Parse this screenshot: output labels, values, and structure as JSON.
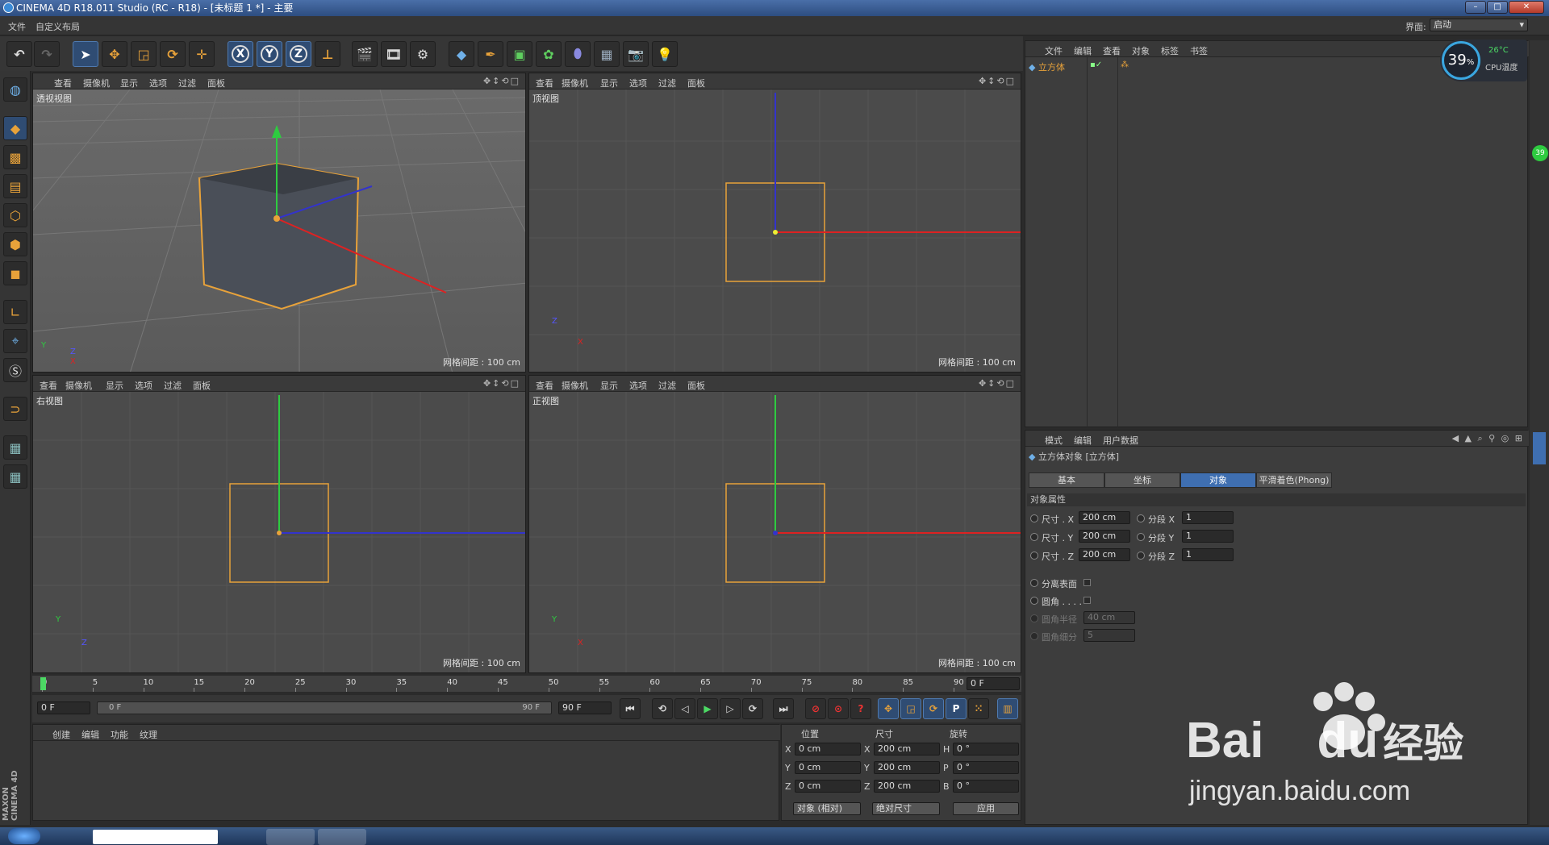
{
  "window": {
    "title": "CINEMA 4D R18.011 Studio (RC - R18) - [未标题 1 *] - 主要",
    "layout_label": "界面:",
    "layout_value": "启动"
  },
  "menu": {
    "file": "文件",
    "custom_layout": "自定义布局"
  },
  "toolbar": {
    "x": "X",
    "y": "Y",
    "z": "Z"
  },
  "viewports": [
    {
      "label": "透视视图",
      "grid": "网格间距 : 100 cm"
    },
    {
      "label": "顶视图",
      "grid": "网格间距 : 100 cm"
    },
    {
      "label": "右视图",
      "grid": "网格间距 : 100 cm"
    },
    {
      "label": "正视图",
      "grid": "网格间距 : 100 cm"
    }
  ],
  "vp_menu": {
    "view": "查看",
    "camera": "摄像机",
    "display": "显示",
    "options": "选项",
    "filter": "过滤",
    "panel": "面板"
  },
  "axis": {
    "x": "X",
    "y": "Y",
    "z": "Z"
  },
  "timeline": {
    "ticks": [
      "0",
      "5",
      "10",
      "15",
      "20",
      "25",
      "30",
      "35",
      "40",
      "45",
      "50",
      "55",
      "60",
      "65",
      "70",
      "75",
      "80",
      "85",
      "90"
    ],
    "end_frame": "0 F"
  },
  "transport": {
    "start": "0 F",
    "slider_start": "0 F",
    "slider_end": "90 F",
    "end": "90 F",
    "p_label": "P"
  },
  "material": {
    "create": "创建",
    "edit": "编辑",
    "function": "功能",
    "texture": "纹理"
  },
  "coords": {
    "pos": "位置",
    "size": "尺寸",
    "rot": "旋转",
    "x": "X",
    "y": "Y",
    "z": "Z",
    "h": "H",
    "p": "P",
    "b": "B",
    "px": "0 cm",
    "py": "0 cm",
    "pz": "0 cm",
    "sx": "200 cm",
    "sy": "200 cm",
    "sz": "200 cm",
    "rh": "0 °",
    "rp": "0 °",
    "rb": "0 °",
    "mode1": "对象 (相对)",
    "mode2": "绝对尺寸",
    "apply": "应用"
  },
  "objects": {
    "menu": [
      "文件",
      "编辑",
      "查看",
      "对象",
      "标签",
      "书签"
    ],
    "item": "立方体"
  },
  "attributes": {
    "menu": [
      "模式",
      "编辑",
      "用户数据"
    ],
    "title": "立方体对象 [立方体]",
    "tabs": [
      "基本",
      "坐标",
      "对象",
      "平滑着色(Phong)"
    ],
    "section": "对象属性",
    "size_x": "尺寸 . X",
    "size_y": "尺寸 . Y",
    "size_z": "尺寸 . Z",
    "size_x_val": "200 cm",
    "size_y_val": "200 cm",
    "size_z_val": "200 cm",
    "seg_x": "分段 X",
    "seg_y": "分段 Y",
    "seg_z": "分段 Z",
    "seg_x_val": "1",
    "seg_y_val": "1",
    "seg_z_val": "1",
    "separate": "分离表面",
    "fillet": "圆角 . . . .",
    "fillet_radius": "圆角半径",
    "fillet_radius_val": "40 cm",
    "fillet_sub": "圆角细分",
    "fillet_sub_val": "5"
  },
  "cpu": {
    "percent": "39",
    "percent_sign": "%",
    "temp": "26°C",
    "temp_label": "CPU温度"
  },
  "side_badge": "39",
  "brand": {
    "maxon": "MAXON",
    "product": "CINEMA 4D"
  },
  "watermark": {
    "text": "Bai",
    "du": "du",
    "jingyan": "经验",
    "url": "jingyan.baidu.com"
  }
}
